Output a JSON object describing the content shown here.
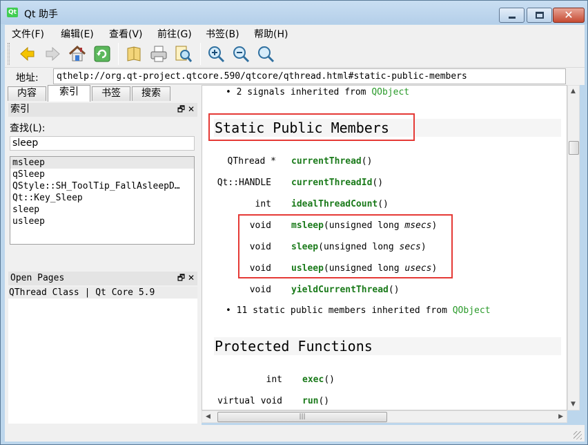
{
  "window": {
    "title": "Qt 助手",
    "app_icon_text": "Qt"
  },
  "menu": [
    "文件(F)",
    "编辑(E)",
    "查看(V)",
    "前往(G)",
    "书签(B)",
    "帮助(H)"
  ],
  "toolbar": {
    "buttons": [
      "back-icon",
      "forward-icon",
      "home-icon",
      "sync-icon",
      "bookmark-icon",
      "print-icon",
      "find-icon",
      "zoom-in-icon",
      "zoom-out-icon",
      "zoom-reset-icon"
    ]
  },
  "address": {
    "label": "地址:",
    "url": "qthelp://org.qt-project.qtcore.590/qtcore/qthread.html#static-public-members"
  },
  "sidebar": {
    "tabs": [
      "内容",
      "索引",
      "书签",
      "搜索"
    ],
    "active_tab": "索引",
    "index_dock_title": "索引",
    "search_label": "查找(L):",
    "search_value": "sleep",
    "index_items": [
      "msleep",
      "qSleep",
      "QStyle::SH_ToolTip_FallAsleepD…",
      "Qt::Key_Sleep",
      "sleep",
      "usleep"
    ],
    "open_pages_title": "Open Pages",
    "open_pages": [
      "QThread Class | Qt Core 5.9"
    ]
  },
  "doc": {
    "signals_line": {
      "bullet": "•",
      "prefix": "2 signals inherited from ",
      "link": "QObject"
    },
    "static_heading": "Static Public Members",
    "members": [
      {
        "type": "QThread *",
        "name": "currentThread",
        "params_pre": "()",
        "param": "",
        "params_post": ""
      },
      {
        "type": "Qt::HANDLE",
        "name": "currentThreadId",
        "params_pre": "()",
        "param": "",
        "params_post": ""
      },
      {
        "type": "int",
        "name": "idealThreadCount",
        "params_pre": "()",
        "param": "",
        "params_post": ""
      },
      {
        "type": "void",
        "name": "msleep",
        "params_pre": "(unsigned long ",
        "param": "msecs",
        "params_post": ")"
      },
      {
        "type": "void",
        "name": "sleep",
        "params_pre": "(unsigned long ",
        "param": "secs",
        "params_post": ")"
      },
      {
        "type": "void",
        "name": "usleep",
        "params_pre": "(unsigned long ",
        "param": "usecs",
        "params_post": ")"
      },
      {
        "type": "void",
        "name": "yieldCurrentThread",
        "params_pre": "()",
        "param": "",
        "params_post": ""
      }
    ],
    "static_inherited_line": {
      "bullet": "•",
      "prefix": "11 static public members inherited from ",
      "link": "QObject"
    },
    "protected_heading": "Protected Functions",
    "protected_members": [
      {
        "type": "int",
        "name": "exec",
        "params": "()"
      },
      {
        "type": "virtual void",
        "name": "run",
        "params": "()"
      }
    ]
  },
  "colors": {
    "highlight": "#e53935",
    "link": "#2a9a2a",
    "function": "#1a7a1a"
  }
}
